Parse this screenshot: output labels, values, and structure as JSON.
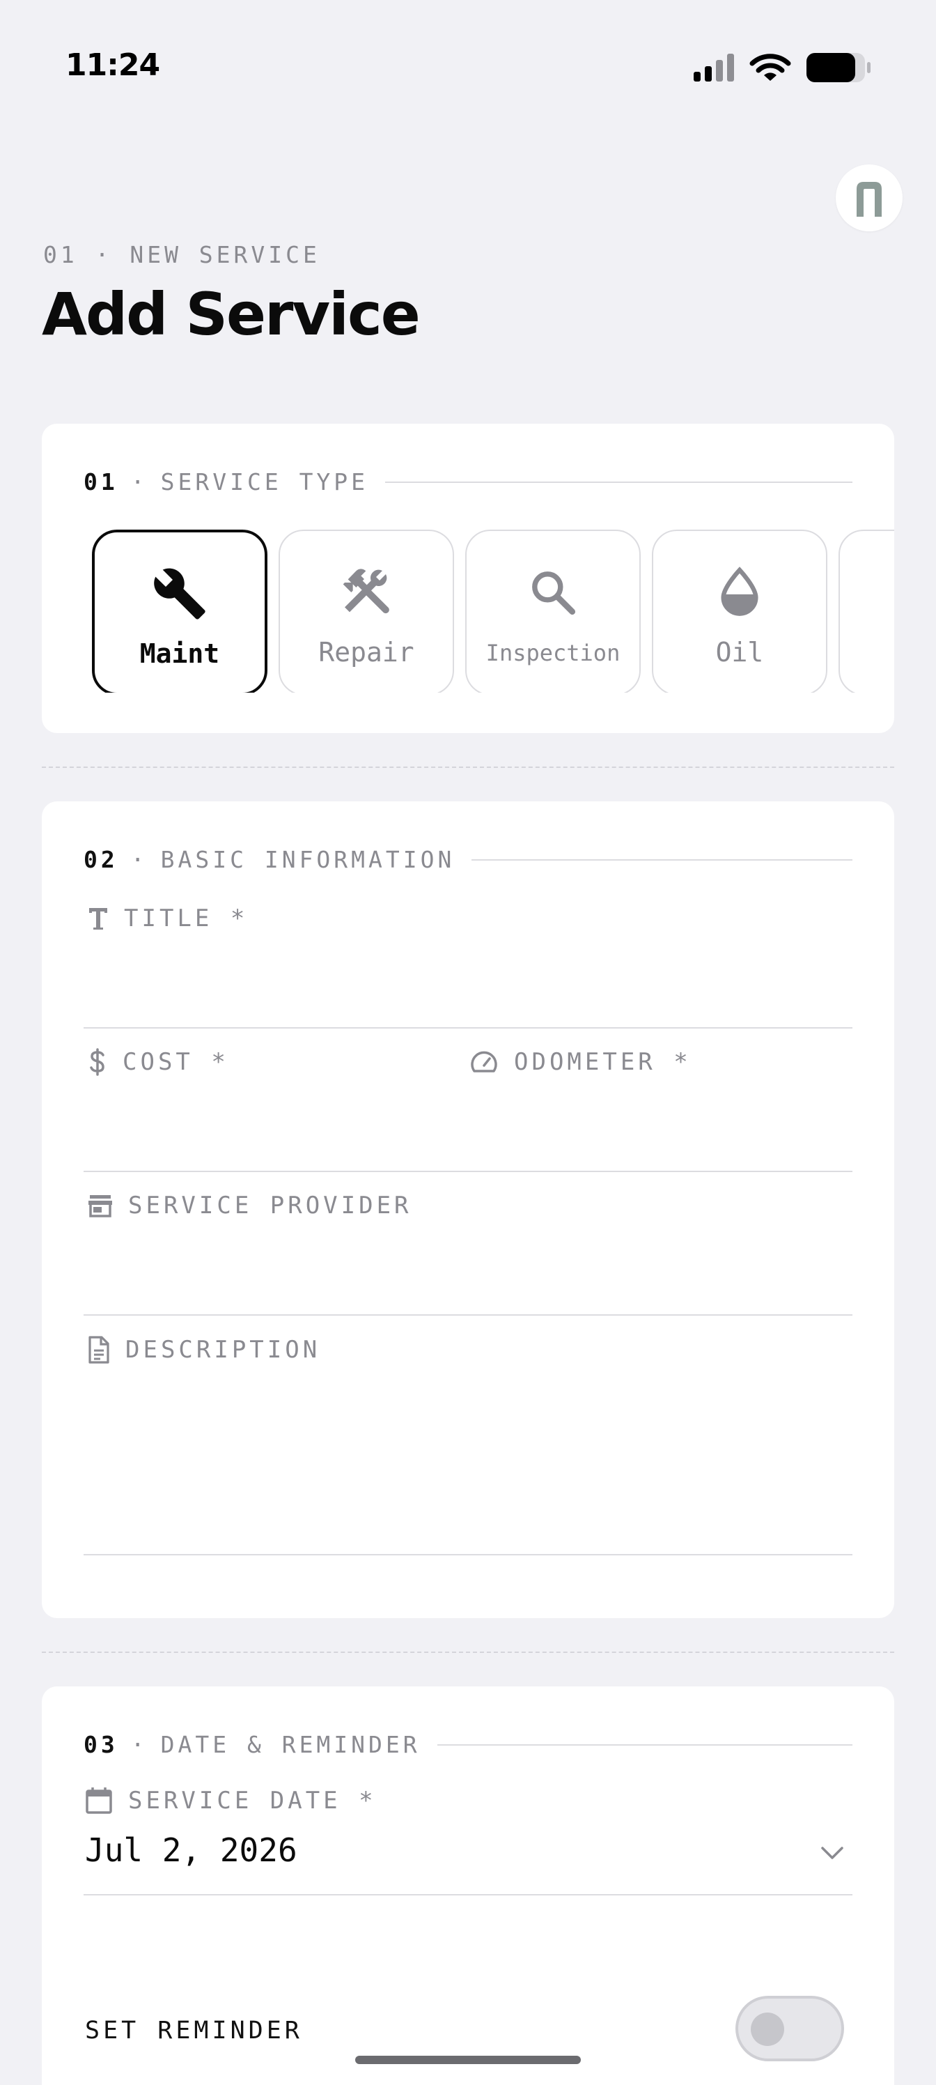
{
  "status_bar": {
    "time": "11:24",
    "signal_icon": "cellular-signal-icon",
    "wifi_icon": "wifi-icon",
    "battery_icon": "battery-icon"
  },
  "header": {
    "avatar_initial": "n",
    "eyebrow": "01 · NEW SERVICE",
    "title": "Add Service"
  },
  "sections": {
    "service_type": {
      "num": "01",
      "dot": "·",
      "label": "SERVICE TYPE"
    },
    "basic_info": {
      "num": "02",
      "dot": "·",
      "label": "BASIC INFORMATION"
    },
    "date_reminder": {
      "num": "03",
      "dot": "·",
      "label": "DATE & REMINDER"
    }
  },
  "service_types": [
    {
      "label": "Maint",
      "icon": "wrench-icon",
      "selected": true
    },
    {
      "label": "Repair",
      "icon": "hammer-wrench-icon",
      "selected": false
    },
    {
      "label": "Inspection",
      "icon": "magnifier-icon",
      "selected": false
    },
    {
      "label": "Oil",
      "icon": "oil-drop-icon",
      "selected": false
    }
  ],
  "fields": {
    "title": {
      "label": "TITLE *",
      "icon": "text-t-icon",
      "value": ""
    },
    "cost": {
      "label": "COST *",
      "icon": "dollar-icon",
      "value": ""
    },
    "odometer": {
      "label": "ODOMETER *",
      "icon": "speedometer-icon",
      "value": ""
    },
    "provider": {
      "label": "SERVICE PROVIDER",
      "icon": "store-icon",
      "value": ""
    },
    "description": {
      "label": "DESCRIPTION",
      "icon": "document-icon",
      "value": ""
    },
    "service_date": {
      "label": "SERVICE DATE *",
      "icon": "calendar-icon",
      "value": "Jul 2, 2026"
    }
  },
  "reminder": {
    "label": "SET REMINDER",
    "enabled": false
  },
  "colors": {
    "background": "#f1f1f5",
    "card": "#ffffff",
    "accent": "#0b0b0b",
    "muted": "#8a8a90",
    "line": "#dcdce0"
  }
}
